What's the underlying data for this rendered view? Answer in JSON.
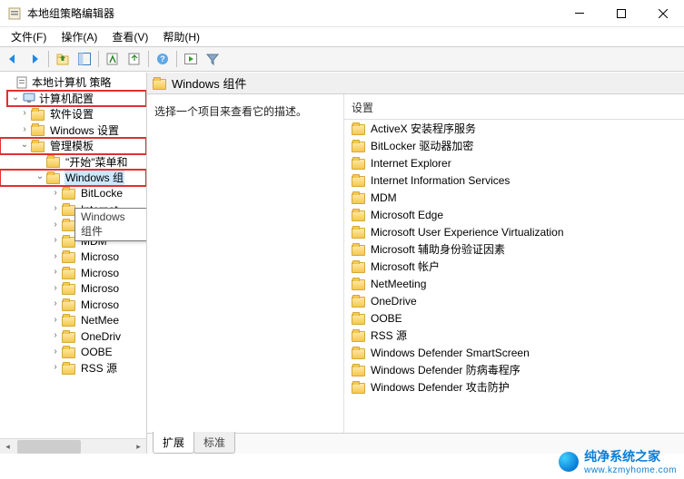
{
  "window": {
    "title": "本地组策略编辑器"
  },
  "menu": {
    "file": "文件(F)",
    "action": "操作(A)",
    "view": "查看(V)",
    "help": "帮助(H)"
  },
  "tree": {
    "root": "本地计算机 策略",
    "computer_config": "计算机配置",
    "sw_settings": "软件设置",
    "win_settings": "Windows 设置",
    "admin_templates": "管理模板",
    "start_menu": "\"开始\"菜单和",
    "win_components": "Windows 组",
    "tooltip": "Windows 组件",
    "items_under": [
      "BitLocke",
      "Internet",
      "Internet",
      "MDM",
      "Microso",
      "Microso",
      "Microso",
      "Microso",
      "NetMee",
      "OneDriv",
      "OOBE",
      "RSS 源"
    ]
  },
  "right": {
    "path_title": "Windows 组件",
    "description_hint": "选择一个项目来查看它的描述。",
    "column_header": "设置",
    "items": [
      "ActiveX 安装程序服务",
      "BitLocker 驱动器加密",
      "Internet Explorer",
      "Internet Information Services",
      "MDM",
      "Microsoft Edge",
      "Microsoft User Experience Virtualization",
      "Microsoft 辅助身份验证因素",
      "Microsoft 帐户",
      "NetMeeting",
      "OneDrive",
      "OOBE",
      "RSS 源",
      "Windows Defender SmartScreen",
      "Windows Defender 防病毒程序",
      "Windows Defender 攻击防护"
    ],
    "tabs": {
      "extended": "扩展",
      "standard": "标准"
    }
  },
  "watermark": {
    "line1": "纯净系统之家",
    "line2": "www.kzmyhome.com"
  }
}
